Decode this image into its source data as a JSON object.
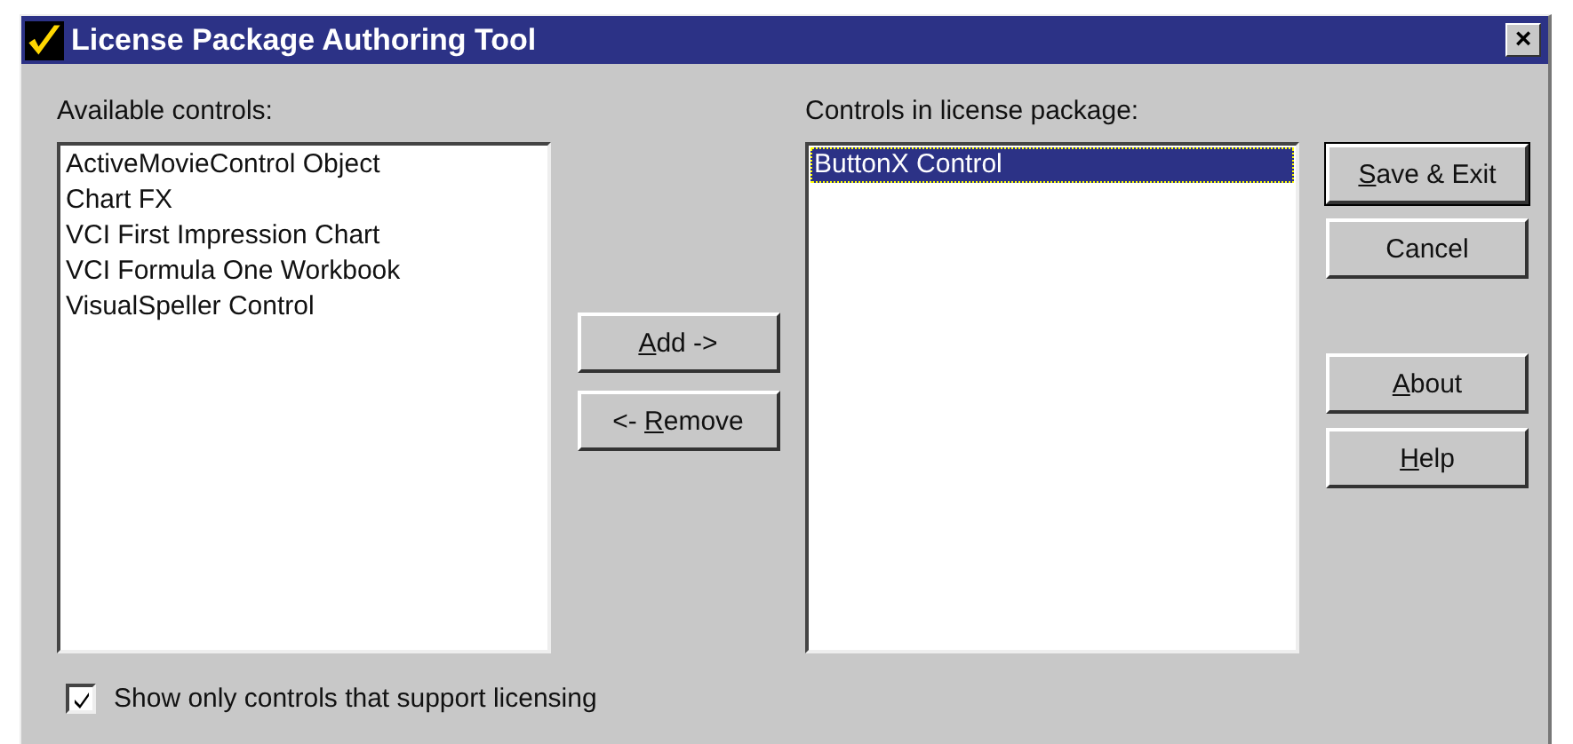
{
  "window": {
    "title": "License Package Authoring Tool",
    "close": "×"
  },
  "available": {
    "label": "Available controls:",
    "items": [
      {
        "text": "ActiveMovieControl Object",
        "selected": false
      },
      {
        "text": "Chart FX",
        "selected": false
      },
      {
        "text": "VCI First Impression Chart",
        "selected": false
      },
      {
        "text": "VCI Formula One Workbook",
        "selected": false
      },
      {
        "text": "VisualSpeller Control",
        "selected": false
      }
    ]
  },
  "middle_buttons": [
    {
      "key": "A",
      "after": "dd ->"
    },
    {
      "before": "<- ",
      "key": "R",
      "after": "emove"
    }
  ],
  "package": {
    "label": "Controls in license package:",
    "items": [
      {
        "text": "ButtonX Control",
        "selected": true
      }
    ]
  },
  "side_buttons": [
    {
      "key": "S",
      "after": "ave & Exit",
      "default": true
    },
    {
      "before": "Cancel",
      "default": false
    },
    {
      "key": "A",
      "after": "bout",
      "default": false
    },
    {
      "key": "H",
      "after": "elp",
      "default": false
    }
  ],
  "checkbox": {
    "label": "Show only controls that support licensing",
    "checked": true
  }
}
